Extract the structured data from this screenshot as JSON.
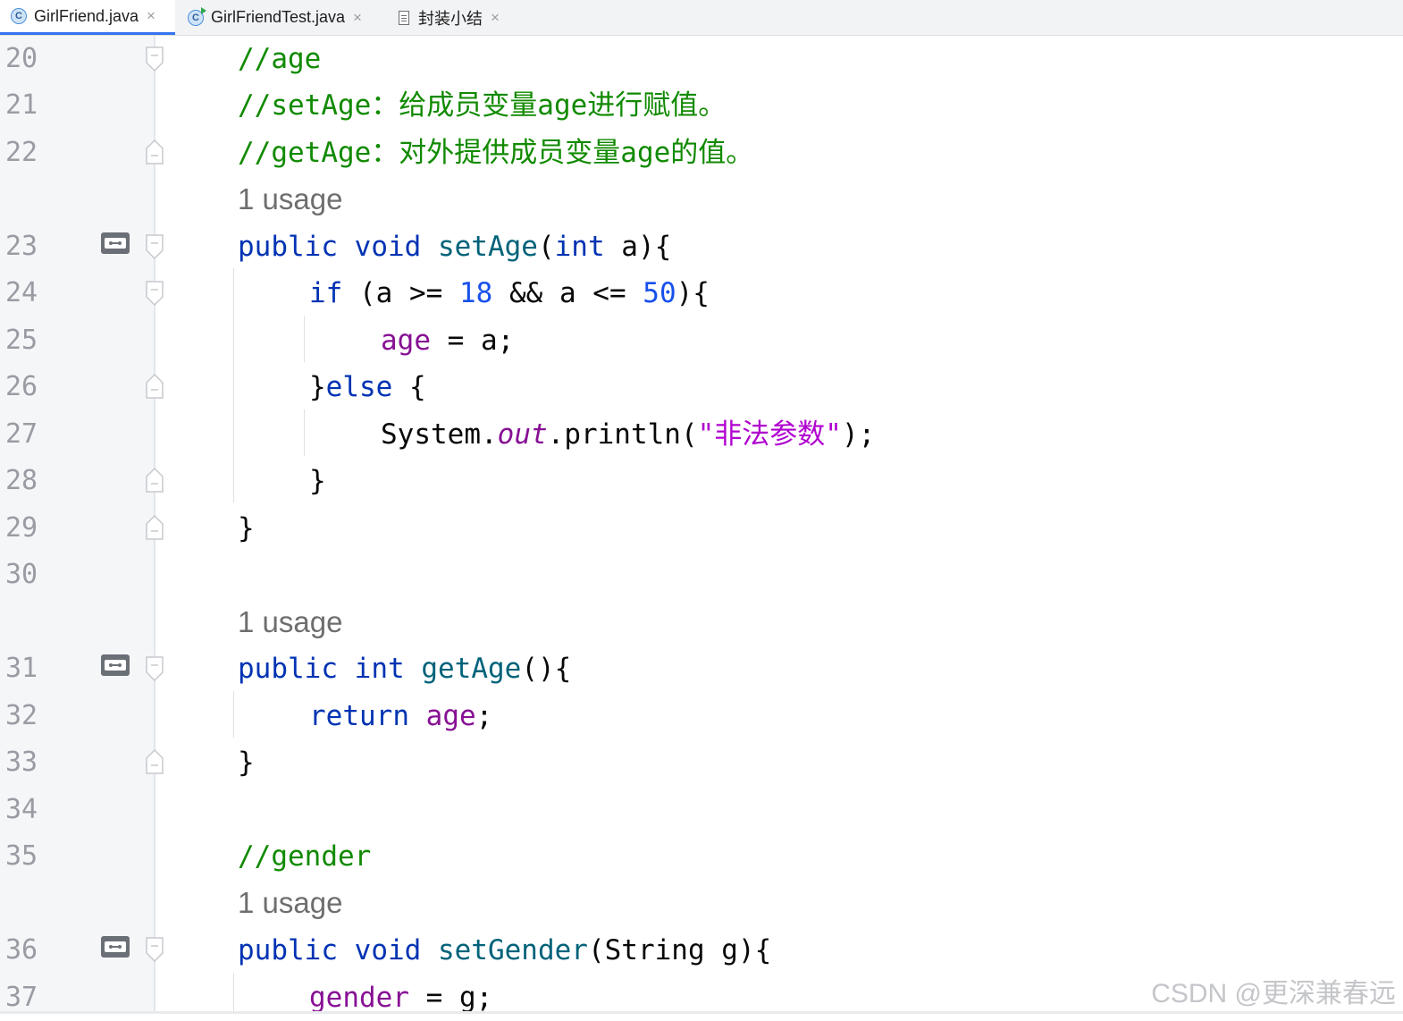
{
  "tabs": [
    {
      "label": "GirlFriend.java",
      "icon": "java-class-icon",
      "active": true,
      "icon_letter": "C"
    },
    {
      "label": "GirlFriendTest.java",
      "icon": "java-runnable-class-icon",
      "active": false,
      "icon_letter": "C"
    },
    {
      "label": "封装小结",
      "icon": "text-file-icon",
      "active": false
    }
  ],
  "close_glyph": "×",
  "line_numbers": [
    "20",
    "21",
    "22",
    "23",
    "24",
    "25",
    "26",
    "27",
    "28",
    "29",
    "30",
    "31",
    "32",
    "33",
    "34",
    "35",
    "36",
    "37"
  ],
  "hints": {
    "set_age_usage": "1 usage",
    "get_age_usage": "1 usage",
    "set_gender_usage": "1 usage"
  },
  "code": {
    "l20_comment": "//age",
    "l21_comment": "//setAge：给成员变量age进行赋值。",
    "l22_comment": "//getAge：对外提供成员变量age的值。",
    "l23": {
      "public": "public",
      "void": "void",
      "name": "setAge",
      "open": "(",
      "int": "int",
      "rest": " a){"
    },
    "l24": {
      "if": "if",
      "a1": " (a >= ",
      "n18": "18",
      "mid": " && a <= ",
      "n50": "50",
      "end": "){"
    },
    "l25": {
      "age": "age",
      "rest": " = a;"
    },
    "l26": {
      "brace": "}",
      "else": "else",
      "rest": " {"
    },
    "l27": {
      "system": "System.",
      "out": "out",
      "println": ".println(",
      "str": "\"非法参数\"",
      "end": ");"
    },
    "l28": "}",
    "l29": "}",
    "l31": {
      "public": "public",
      "int": "int",
      "name": "getAge",
      "rest": "(){"
    },
    "l32": {
      "return": "return",
      "age": "age",
      "end": ";"
    },
    "l33": "}",
    "l35_comment": "//gender",
    "l36": {
      "public": "public",
      "void": "void",
      "name": "setGender",
      "rest": "(String g){"
    },
    "l37": {
      "gender": "gender",
      "rest": " = g;"
    }
  },
  "watermark": "CSDN @更深兼春远",
  "colors": {
    "keyword": "#0033b3",
    "method": "#00627a",
    "field": "#871094",
    "number": "#1750eb",
    "string": "#b000d0",
    "comment": "#118a00",
    "tab_accent": "#3574f0"
  }
}
